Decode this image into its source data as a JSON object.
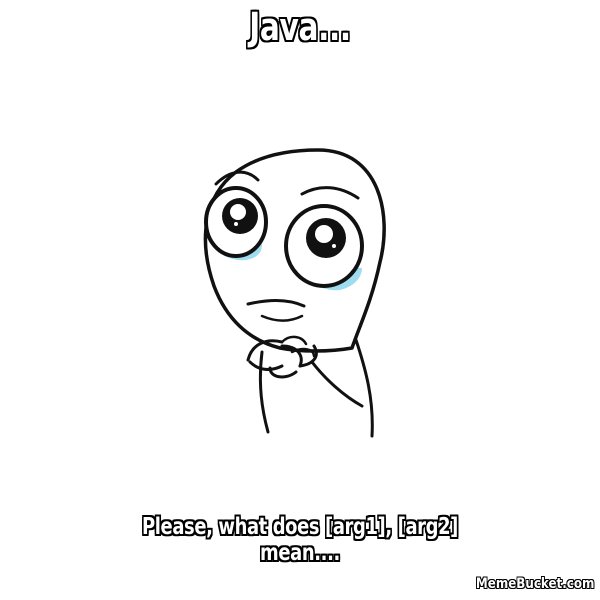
{
  "meme": {
    "top_text": "Java...",
    "bottom_text_line1": "Please, what does [arg1], [arg2]",
    "bottom_text_line2": "mean....",
    "watermark": "MemeBucket.com",
    "character": "pleading-rage-face-icon"
  },
  "colors": {
    "background": "#ffffff",
    "text_fill": "#ffffff",
    "text_outline": "#000000",
    "tears": "#9fdcf0"
  }
}
